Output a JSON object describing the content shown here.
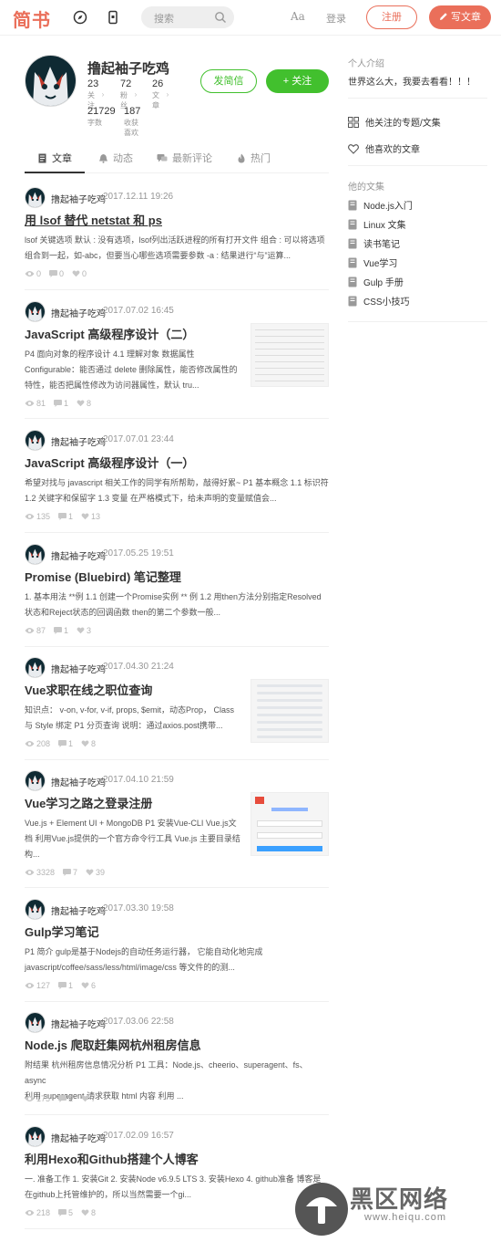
{
  "nav": {
    "logo": "简书",
    "search_placeholder": "搜索",
    "font_toggle": "Aa",
    "login": "登录",
    "register": "注册",
    "write": "写文章"
  },
  "profile": {
    "name": "撸起袖子吃鸡",
    "stats": [
      {
        "num": "23",
        "label": "关注"
      },
      {
        "num": "72",
        "label": "粉丝"
      },
      {
        "num": "26",
        "label": "文章"
      },
      {
        "num": "21729",
        "label": "字数"
      },
      {
        "num": "187",
        "label": "收获喜欢"
      }
    ],
    "message_button": "发简信",
    "follow_button": "+ 关注"
  },
  "tabs": [
    {
      "label": "文章"
    },
    {
      "label": "动态"
    },
    {
      "label": "最新评论"
    },
    {
      "label": "热门"
    }
  ],
  "articles": [
    {
      "author": "撸起袖子吃鸡",
      "time": "2017.12.11 19:26",
      "title": "用 lsof 替代 netstat 和 ps",
      "abstract": [
        "lsof 关键选项 默认 : 没有选项，lsof列出活跃进程的所有打开文件 组合 : 可以将选项",
        "组合到一起，如-abc，但要当心哪些选项需要参数 -a : 结果进行“与”运算..."
      ],
      "views": "0",
      "comments": "0",
      "likes": "0"
    },
    {
      "author": "撸起袖子吃鸡",
      "time": "2017.07.02 16:45",
      "title": "JavaScript 高级程序设计（二）",
      "abstract": [
        "P4 面向对象的程序设计 4.1 理解对象 数据属性",
        "Configurable：能否通过 delete 删除属性，能否修改属性的",
        "特性，能否把属性修改为访问器属性，默认 tru..."
      ],
      "views": "81",
      "comments": "1",
      "likes": "8"
    },
    {
      "author": "撸起袖子吃鸡",
      "time": "2017.07.01 23:44",
      "title": "JavaScript 高级程序设计（一）",
      "abstract": [
        "希望对找与 javascript 相关工作的同学有所帮助，敲得好累~ P1 基本概念 1.1 标识符",
        "1.2 关键字和保留字 1.3 变量 在严格模式下，给未声明的变量赋值会..."
      ],
      "views": "135",
      "comments": "1",
      "likes": "13"
    },
    {
      "author": "撸起袖子吃鸡",
      "time": "2017.05.25 19:51",
      "title": "Promise (Bluebird) 笔记整理",
      "abstract": [
        "1. 基本用法 **例 1.1 创建一个Promise实例 ** 例 1.2 用then方法分别指定Resolved",
        "状态和Reject状态的回调函数 then的第二个参数一般..."
      ],
      "views": "87",
      "comments": "1",
      "likes": "3"
    },
    {
      "author": "撸起袖子吃鸡",
      "time": "2017.04.30 21:24",
      "title": "Vue求职在线之职位查询",
      "abstract": [
        "知识点： v-on, v-for, v-if, props, $emit，动态Prop， Class",
        "与 Style 绑定 P1 分页查询 说明：通过axios.post携带..."
      ],
      "views": "208",
      "comments": "1",
      "likes": "8"
    },
    {
      "author": "撸起袖子吃鸡",
      "time": "2017.04.10 21:59",
      "title": "Vue学习之路之登录注册",
      "abstract": [
        "Vue.js + Element UI + MongoDB P1 安装Vue-CLI Vue.js文",
        "档 利用Vue.js提供的一个官方命令行工具 Vue.js 主要目录结",
        "构..."
      ],
      "views": "3328",
      "comments": "7",
      "likes": "39"
    },
    {
      "author": "撸起袖子吃鸡",
      "time": "2017.03.30 19:58",
      "title": "Gulp学习笔记",
      "abstract": [
        "P1 简介 gulp是基于Nodejs的自动任务运行器， 它能自动化地完成",
        "javascript/coffee/sass/less/html/image/css 等文件的的测..."
      ],
      "views": "127",
      "comments": "1",
      "likes": "6"
    },
    {
      "author": "撸起袖子吃鸡",
      "time": "2017.03.06 22:58",
      "title": "Node.js 爬取赶集网杭州租房信息",
      "abstract": [
        "附结果 杭州租房信息情况分析 P1 工具：Node.js、cheerio、superagent、fs、async",
        "利用 superagent 请求获取 html 内容 利用 ..."
      ],
      "views": "175",
      "comments": "1",
      "likes": "7"
    },
    {
      "author": "撸起袖子吃鸡",
      "time": "2017.02.09 16:57",
      "title": "利用Hexo和Github搭建个人博客",
      "abstract": [
        "一. 准备工作 1. 安装Git 2. 安装Node v6.9.5 LTS 3. 安装Hexo 4. github准备 博客是",
        "在github上托管维护的，所以当然需要一个gi..."
      ],
      "views": "218",
      "comments": "5",
      "likes": "8"
    }
  ],
  "sidebar": {
    "intro_title": "个人介绍",
    "intro_text": "世界这么大，我要去看看！！！",
    "links": [
      {
        "label": "他关注的专题/文集",
        "icon": "grid-icon"
      },
      {
        "label": "他喜欢的文章",
        "icon": "heart-icon"
      }
    ],
    "collections_title": "他的文集",
    "collections": [
      {
        "label": "Node.js入门"
      },
      {
        "label": "Linux 文集"
      },
      {
        "label": "读书笔记"
      },
      {
        "label": "Vue学习"
      },
      {
        "label": "Gulp 手册"
      },
      {
        "label": "CSS小技巧"
      }
    ]
  },
  "watermark": {
    "text": "黑区网络",
    "url": "www.heiqu.com"
  },
  "colors": {
    "brand": "#ea6f5a",
    "follow_green": "#42c02e",
    "muted": "#969696"
  }
}
